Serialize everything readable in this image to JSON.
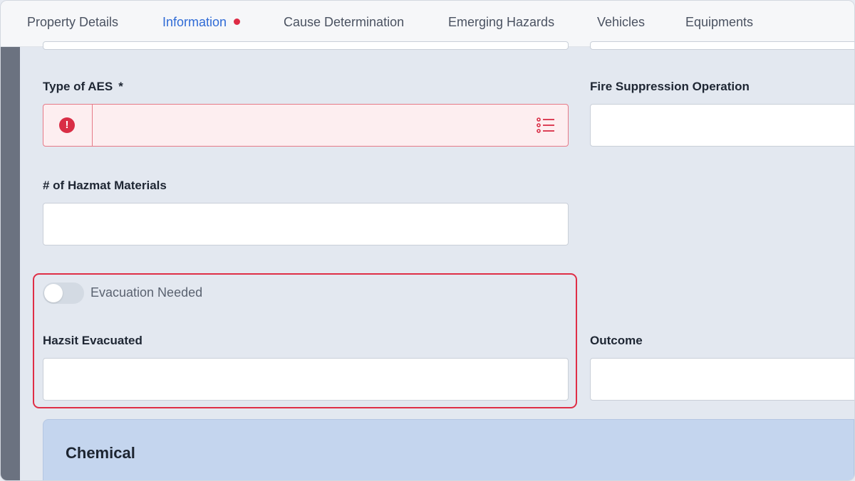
{
  "tabs": [
    {
      "label": "Property Details"
    },
    {
      "label": "Information"
    },
    {
      "label": "Cause Determination"
    },
    {
      "label": "Emerging Hazards"
    },
    {
      "label": "Vehicles"
    },
    {
      "label": "Equipments"
    }
  ],
  "active_tab": "Information",
  "form": {
    "type_of_aes": {
      "label": "Type of AES",
      "required_mark": "*",
      "value": ""
    },
    "fire_suppression_operation": {
      "label": "Fire Suppression Operation",
      "value": ""
    },
    "hazmat_materials_count": {
      "label": "# of Hazmat Materials",
      "value": ""
    },
    "evacuation_needed": {
      "label": "Evacuation Needed",
      "checked": false
    },
    "hazsit_evacuated": {
      "label": "Hazsit Evacuated",
      "value": ""
    },
    "outcome": {
      "label": "Outcome",
      "value": ""
    }
  },
  "error_icon_glyph": "!",
  "section": {
    "title": "Chemical"
  },
  "colors": {
    "accent": "#2f6bd6",
    "error": "#d92e46",
    "error_background": "#fdeef0",
    "highlight_outline": "#df2e46",
    "section_background": "#c4d5ee"
  }
}
